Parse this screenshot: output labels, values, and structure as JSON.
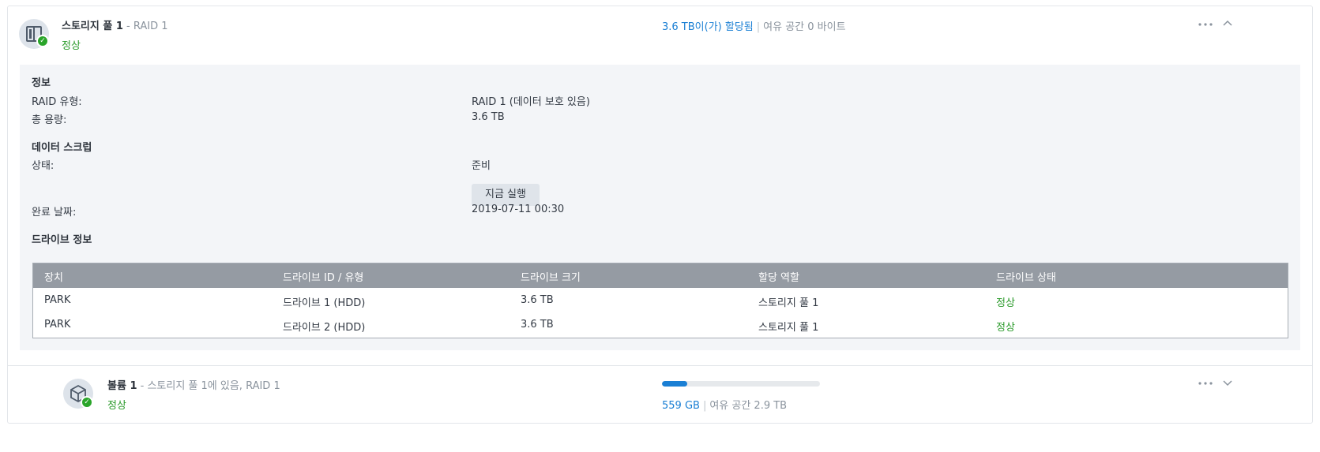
{
  "pool": {
    "name": "스토리지 풀 1",
    "raid_suffix": " - RAID 1",
    "status": "정상",
    "allocated": "3.6 TB이(가) 할당됨",
    "separator": "|",
    "free": "여유 공간 0 바이트"
  },
  "info": {
    "heading": "정보",
    "raid_type_label": "RAID 유형:",
    "raid_type_value": "RAID 1 (데이터 보호 있음)",
    "capacity_label": "총 용량:",
    "capacity_value": "3.6 TB"
  },
  "scrub": {
    "heading": "데이터 스크럽",
    "status_label": "상태:",
    "status_value": "준비",
    "run_button": "지금 실행",
    "completed_label": "완료 날짜:",
    "completed_value": "2019-07-11 00:30"
  },
  "drives": {
    "heading": "드라이브 정보",
    "columns": [
      "장치",
      "드라이브 ID / 유형",
      "드라이브 크기",
      "할당 역할",
      "드라이브 상태"
    ],
    "rows": [
      [
        "PARK",
        "드라이브 1 (HDD)",
        "3.6 TB",
        "스토리지 풀 1",
        "정상"
      ],
      [
        "PARK",
        "드라이브 2 (HDD)",
        "3.6 TB",
        "스토리지 풀 1",
        "정상"
      ]
    ]
  },
  "volume": {
    "name": "볼륨 1",
    "suffix": " - 스토리지 풀 1에 있음, RAID 1",
    "status": "정상",
    "used": "559 GB",
    "separator": "|",
    "free": "여유 공간 2.9 TB",
    "usage_fraction": 0.16
  },
  "colors": {
    "accent": "#1a7fd4",
    "ok": "#2a9a2a",
    "table_header": "#959ba3",
    "detail_bg": "#f3f5f8"
  },
  "icons": {
    "pool": "storage-pool-icon",
    "volume": "volume-cube-icon",
    "status_ok": "check-circle-icon",
    "more": "more-horizontal-icon",
    "collapse": "chevron-up-icon",
    "expand": "chevron-down-icon"
  }
}
